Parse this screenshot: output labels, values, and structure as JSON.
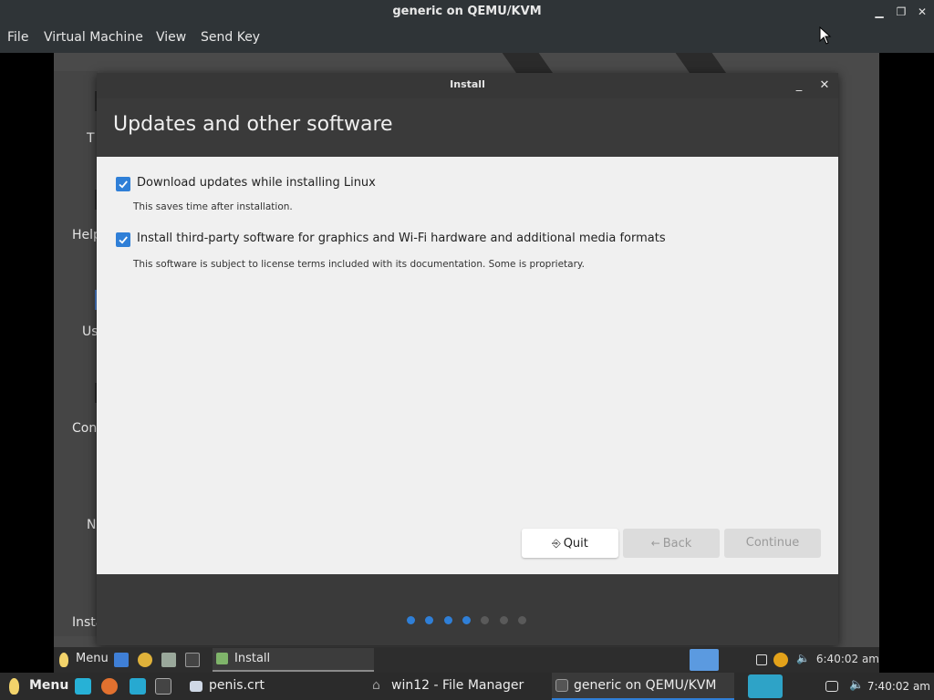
{
  "host_window": {
    "title": "generic on QEMU/KVM",
    "menu": [
      "File",
      "Virtual Machine",
      "View",
      "Send Key"
    ]
  },
  "guest_sidebar": {
    "labels": [
      "T",
      "Help",
      "Us",
      "Con",
      "N",
      "Insta"
    ]
  },
  "install_dialog": {
    "window_title": "Install",
    "minimize_glyph": "_",
    "close_glyph": "✕",
    "heading": "Updates and other software",
    "options": [
      {
        "label": "Download updates while installing Linux",
        "description": "This saves time after installation.",
        "checked": true
      },
      {
        "label": "Install third-party software for graphics and Wi-Fi hardware and additional media formats",
        "description": "This software is subject to license terms included with its documentation. Some is proprietary.",
        "checked": true
      }
    ],
    "buttons": {
      "quit": "Quit",
      "back": "Back",
      "continue": "Continue"
    },
    "progress": {
      "total_steps": 7,
      "completed_steps": 4,
      "active_color": "#2f7fd7",
      "inactive_color": "#5a5a5a"
    }
  },
  "guest_panel": {
    "menu_label": "Menu",
    "task_label": "Install",
    "clock": "6:40:02 am"
  },
  "host_panel": {
    "menu_label": "Menu",
    "tasks": [
      {
        "label": "penis.crt"
      },
      {
        "label": "win12 - File Manager"
      },
      {
        "label": "generic on QEMU/KVM"
      }
    ],
    "clock": "7:40:02 am"
  },
  "colors": {
    "accent": "#2f7fd7",
    "dialog_header": "#3a3a3a",
    "content_bg": "#f0f0f0"
  }
}
